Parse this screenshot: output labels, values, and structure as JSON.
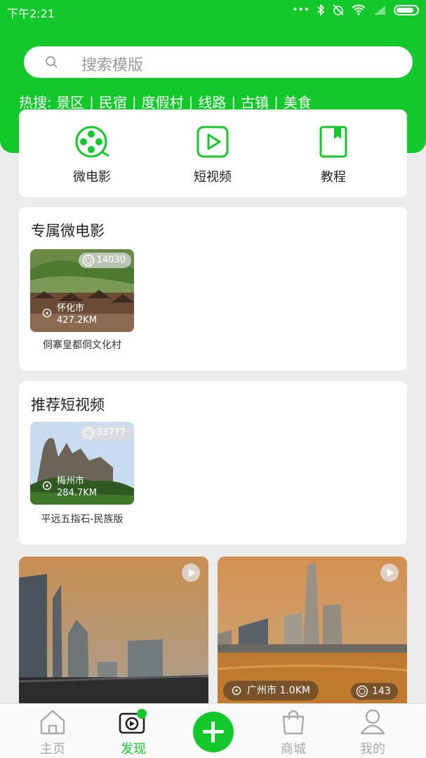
{
  "status": {
    "time": "下午2:21"
  },
  "search": {
    "placeholder": "搜索模版"
  },
  "hot": {
    "label": "热搜:",
    "items": [
      "景区",
      "民宿",
      "度假村",
      "线路",
      "古镇",
      "美食"
    ]
  },
  "quick": {
    "items": [
      {
        "label": "微电影",
        "icon": "film-reel-icon"
      },
      {
        "label": "短视频",
        "icon": "play-square-icon"
      },
      {
        "label": "教程",
        "icon": "bookmark-book-icon"
      }
    ]
  },
  "sections": {
    "micro_film": {
      "title": "专属微电影",
      "card": {
        "views": "14030",
        "city": "怀化市",
        "distance": "427.2KM",
        "name": "侗寨皇都侗文化村"
      }
    },
    "short_video": {
      "title": "推荐短视频",
      "card": {
        "views": "33777",
        "city": "梅州市",
        "distance": "284.7KM",
        "name": "平远五指石-民族版"
      }
    }
  },
  "feed": [
    {
      "city": "",
      "views": ""
    },
    {
      "city": "广州市 1.0KM",
      "views": "143"
    }
  ],
  "tabbar": {
    "items": [
      {
        "label": "主页",
        "icon": "home-icon",
        "active": false
      },
      {
        "label": "发现",
        "icon": "camera-icon",
        "active": true
      },
      {
        "label": "",
        "icon": "plus-icon",
        "active": false
      },
      {
        "label": "商城",
        "icon": "shopping-bag-icon",
        "active": false
      },
      {
        "label": "我的",
        "icon": "user-icon",
        "active": false
      }
    ]
  },
  "colors": {
    "brand": "#13c82a",
    "background": "#ececec"
  }
}
